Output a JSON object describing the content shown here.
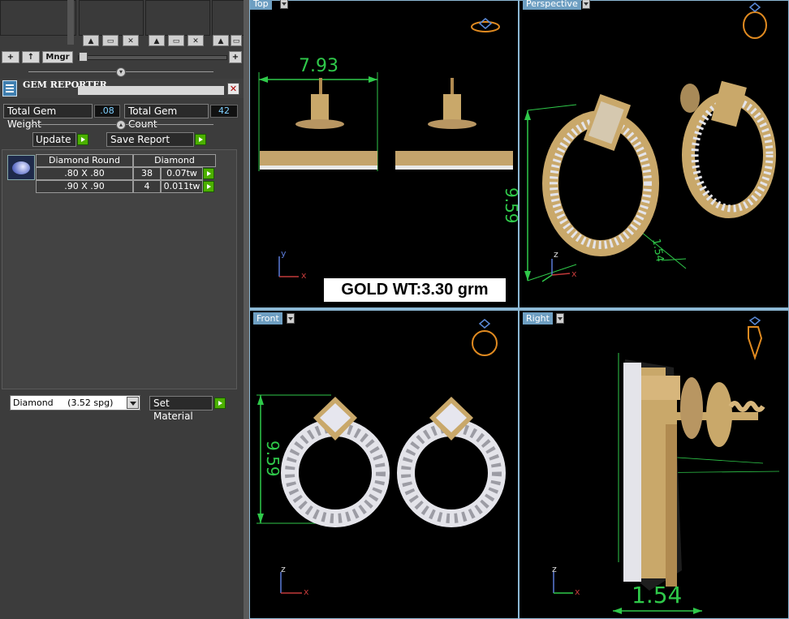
{
  "toolbar": {
    "add_label": "+",
    "up_label": "↑",
    "manager_label": "Mngr",
    "plus_label": "+"
  },
  "gem_reporter": {
    "title": "GEM REPORTER",
    "total_gem_weight_label": "Total Gem Weight",
    "total_gem_weight_value": ".08",
    "total_gem_count_label": "Total Gem Count",
    "total_gem_count_value": "42",
    "update_label": "Update",
    "save_report_label": "Save Report",
    "table": {
      "headers": [
        "Diamond Round",
        "Diamond"
      ],
      "rows": [
        {
          "size": ".80 X .80",
          "count": "38",
          "weight": "0.07tw"
        },
        {
          "size": ".90 X .90",
          "count": "4",
          "weight": "0.011tw"
        }
      ]
    },
    "material_select": "Diamond     (3.52 spg)",
    "set_material_label": "Set Material"
  },
  "viewports": {
    "top": {
      "label": "Top",
      "dimension": "7.93",
      "gold_weight": "GOLD WT:3.30 grm",
      "axis_y": "y",
      "axis_x": "x"
    },
    "perspective": {
      "label": "Perspective",
      "dimension_height": "9.59",
      "dimension_width": "1.54",
      "axis_z": "z",
      "axis_x": "x"
    },
    "front": {
      "label": "Front",
      "dimension": "9.59",
      "axis_z": "z",
      "axis_x": "x"
    },
    "right": {
      "label": "Right",
      "dimension": "1.54",
      "axis_z": "z",
      "axis_x": "x"
    }
  },
  "colors": {
    "dimension_green": "#2fc94a",
    "gold": "#c9a86a",
    "viewport_border": "#8cb8d4",
    "tab_blue": "#6e9fc2",
    "action_green": "#4cb000"
  }
}
